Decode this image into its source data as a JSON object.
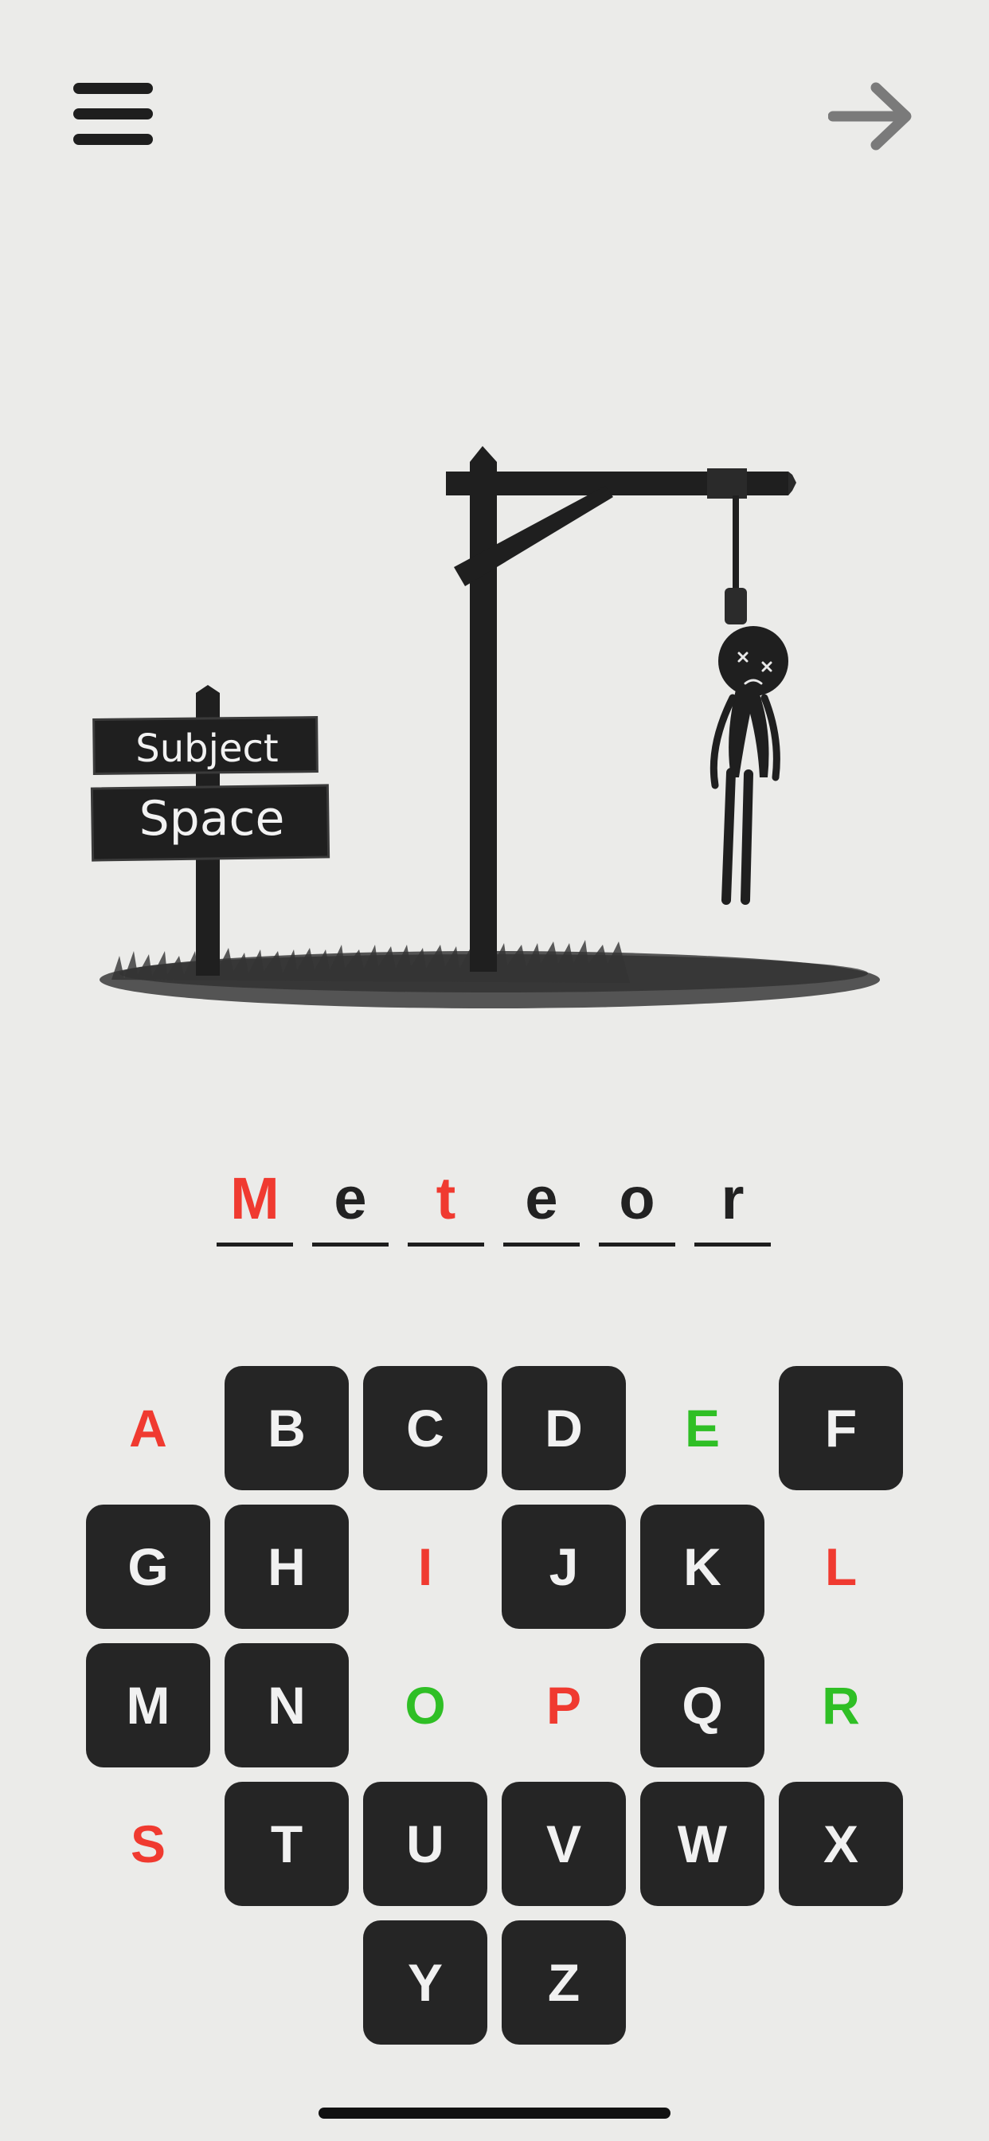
{
  "header": {
    "menu_icon": "hamburger-menu-icon",
    "next_icon": "arrow-right-icon"
  },
  "sign": {
    "subject_label": "Subject",
    "subject_value": "Space"
  },
  "word": {
    "letters": [
      "M",
      "e",
      "t",
      "e",
      "o",
      "r"
    ],
    "missed_letters": [
      "M",
      "t"
    ]
  },
  "keyboard": {
    "rows": [
      [
        "A",
        "B",
        "C",
        "D",
        "E",
        "F"
      ],
      [
        "G",
        "H",
        "I",
        "J",
        "K",
        "L"
      ],
      [
        "M",
        "N",
        "O",
        "P",
        "Q",
        "R"
      ],
      [
        "S",
        "T",
        "U",
        "V",
        "W",
        "X"
      ],
      [
        "Y",
        "Z"
      ]
    ],
    "wrong_guesses": [
      "A",
      "I",
      "L",
      "P",
      "S"
    ],
    "correct_guesses": [
      "E",
      "O",
      "R"
    ]
  },
  "colors": {
    "background": "#ebebe9",
    "key": "#252525",
    "wrong": "#f03a30",
    "correct": "#2fbf25",
    "ink": "#1e1e1e"
  }
}
